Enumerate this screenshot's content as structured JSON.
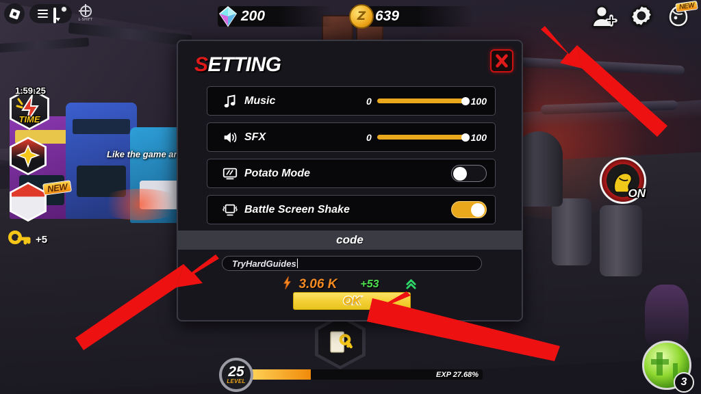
{
  "topbar": {
    "roblox_logo": "roblox-logo",
    "menu_icon": "hamburger-menu-icon",
    "chat_icon": "chat-icon",
    "target_label": "L-SHIFT"
  },
  "currencies": [
    {
      "icon": "gem-icon",
      "value": "200"
    },
    {
      "icon": "coin-icon",
      "value": "639"
    }
  ],
  "top_right_icons": [
    {
      "name": "add-friend-icon",
      "badge": ""
    },
    {
      "name": "settings-gear-icon",
      "badge": ""
    },
    {
      "name": "pet-egg-icon",
      "badge": "NEW"
    }
  ],
  "left_stack": {
    "timer": "1:59:25",
    "time_label": "TIME",
    "star_label": "star-reward-icon",
    "new_label": "NEW",
    "key_icon": "key-icon",
    "key_value": "+5"
  },
  "right_side": {
    "flex_label": "ON",
    "flex_icon": "flex-muscle-icon",
    "ability_count": "3",
    "ability_icon": "green-orb-icon"
  },
  "bottom": {
    "level_number": "25",
    "level_label": "LEVEL",
    "exp_text": "EXP 27.68%",
    "exp_percent": 27.68,
    "quest_icon": "key-quest-icon"
  },
  "background": {
    "billboard_text": "Like the game and j"
  },
  "modal": {
    "title_first": "S",
    "title_rest": "ETTING",
    "close_icon": "close-x-icon",
    "rows": [
      {
        "icon": "music-note-icon",
        "label": "Music",
        "type": "slider",
        "min": "0",
        "max": "100",
        "value": 100
      },
      {
        "icon": "speaker-icon",
        "label": "SFX",
        "type": "slider",
        "min": "0",
        "max": "100",
        "value": 100
      },
      {
        "icon": "monitor-low-icon",
        "label": "Potato Mode",
        "type": "toggle",
        "state": "off"
      },
      {
        "icon": "monitor-shake-icon",
        "label": "Battle Screen Shake",
        "type": "toggle",
        "state": "on"
      }
    ],
    "code_section": {
      "header": "code",
      "input_value": "TryHardGuides",
      "placeholder": "code",
      "stat_icon": "lightning-bolt-icon",
      "stat_value": "3.06 K",
      "stat_gain": "+53",
      "arrow_icon": "double-chevron-up-icon",
      "ok_label": "OK"
    }
  },
  "colors": {
    "accent_orange": "#eaa81c",
    "title_red": "#e01a1a",
    "ok_yellow": "#f3cf34",
    "gain_green": "#4fe04f",
    "arrow_red": "#ee1111"
  }
}
